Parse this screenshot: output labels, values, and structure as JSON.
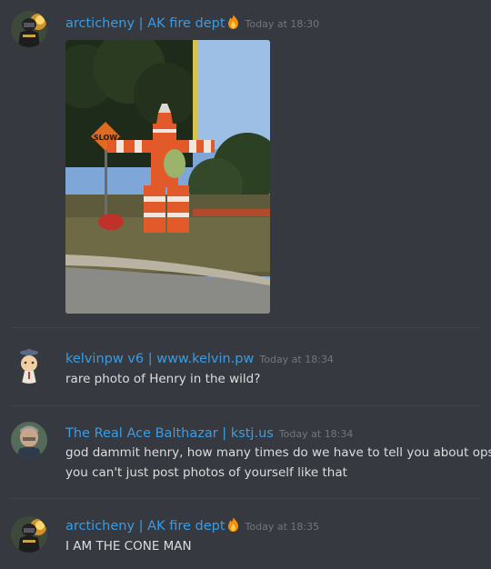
{
  "messages": [
    {
      "username": "arcticheny | AK fire dept",
      "timestamp": "Today at 18:30",
      "text": ""
    },
    {
      "username": "kelvinpw v6 | www.kelvin.pw",
      "timestamp": "Today at 18:34",
      "text": "rare photo of Henry in the wild?"
    },
    {
      "username": "The Real Ace Balthazar | kstj.us",
      "timestamp": "Today at 18:34",
      "line1": "god dammit henry, how many times do we have to tell you about opsec",
      "line2": "you can't just post photos of yourself like that"
    },
    {
      "username": "arcticheny | AK fire dept",
      "timestamp": "Today at 18:35",
      "text": "I AM THE CONE MAN"
    }
  ],
  "sign_text": "SLOW",
  "colors": {
    "background": "#36393f",
    "username": "#3a9ce4",
    "timestamp": "#72767d",
    "text": "#dcddde",
    "divider": "#40444b"
  },
  "icons": [
    "fire-emoji-icon"
  ]
}
